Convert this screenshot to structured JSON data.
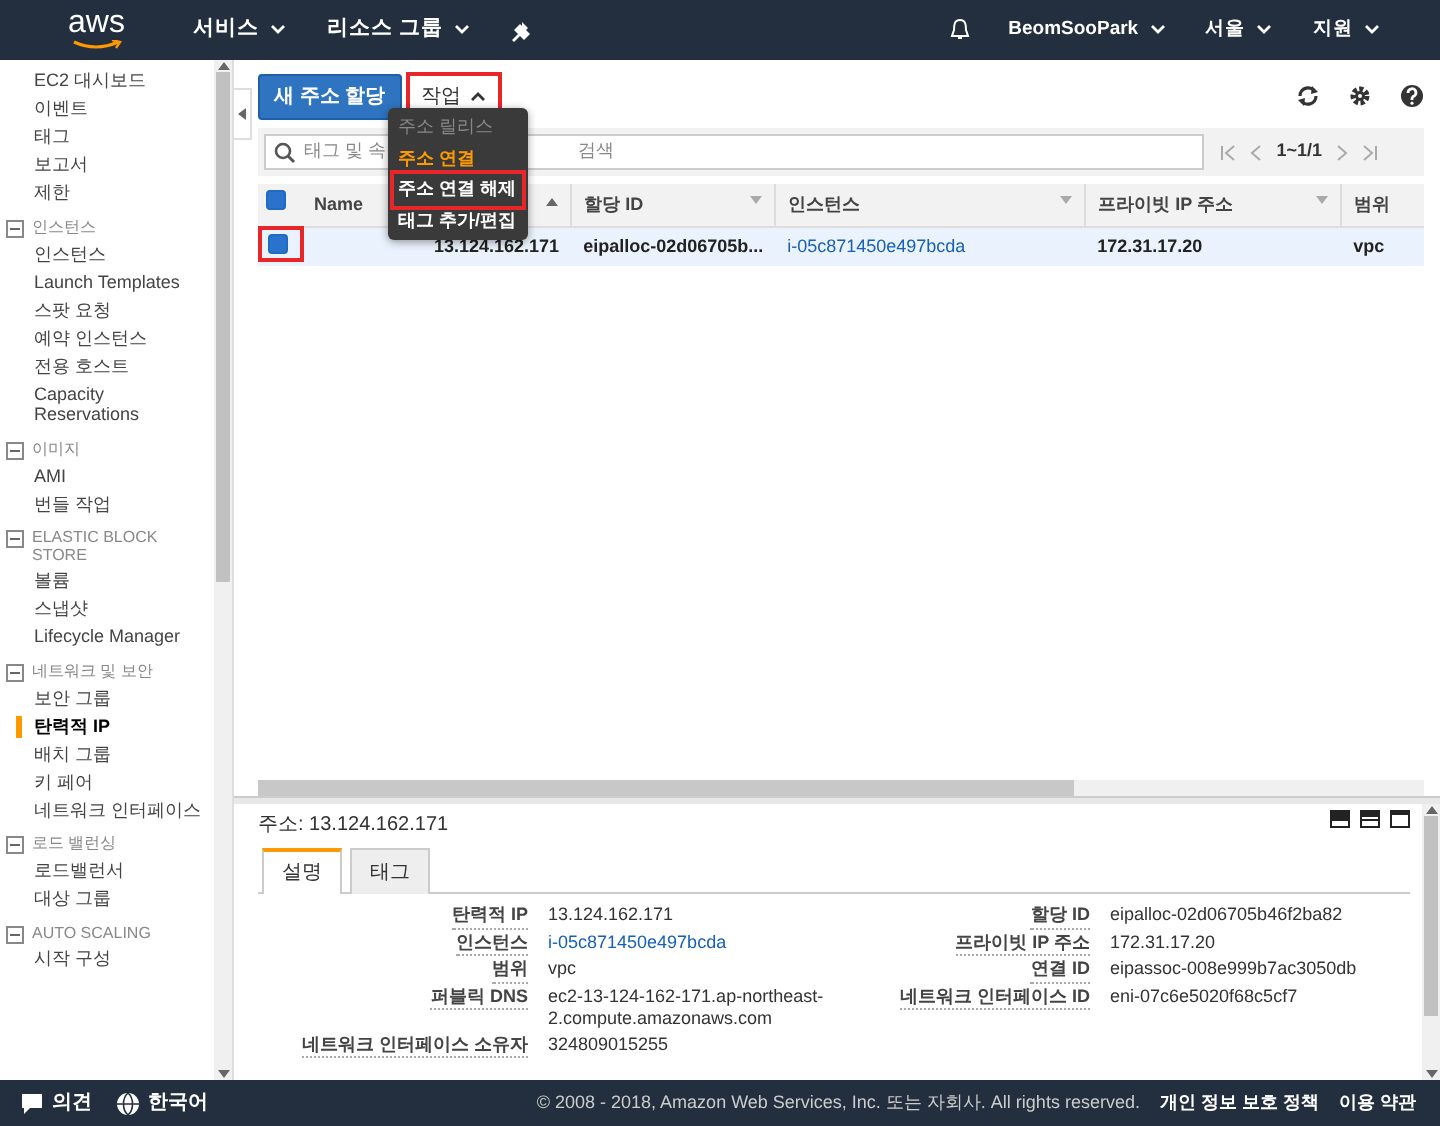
{
  "top_nav": {
    "logo": "aws",
    "menus": [
      {
        "label": "서비스"
      },
      {
        "label": "리소스 그룹"
      }
    ],
    "right_menus": [
      {
        "label": "BeomSooPark"
      },
      {
        "label": "서울"
      },
      {
        "label": "지원"
      }
    ]
  },
  "sidebar": {
    "items": [
      {
        "label": "EC2 대시보드",
        "selected": false
      },
      {
        "label": "이벤트",
        "selected": false
      },
      {
        "label": "태그",
        "selected": false
      },
      {
        "label": "보고서",
        "selected": false
      },
      {
        "label": "제한",
        "selected": false
      }
    ],
    "sections": [
      {
        "label": "인스턴스",
        "expanded": true,
        "items": [
          {
            "label": "인스턴스",
            "selected": false
          },
          {
            "label": "Launch Templates",
            "selected": false
          },
          {
            "label": "스팟 요청",
            "selected": false
          },
          {
            "label": "예약 인스턴스",
            "selected": false
          },
          {
            "label": "전용 호스트",
            "selected": false
          },
          {
            "label": "Capacity Reservations",
            "selected": false
          }
        ]
      },
      {
        "label": "이미지",
        "expanded": true,
        "items": [
          {
            "label": "AMI",
            "selected": false
          },
          {
            "label": "번들 작업",
            "selected": false
          }
        ]
      },
      {
        "label": "ELASTIC BLOCK STORE",
        "expanded": true,
        "items": [
          {
            "label": "볼륨",
            "selected": false
          },
          {
            "label": "스냅샷",
            "selected": false
          },
          {
            "label": "Lifecycle Manager",
            "selected": false
          }
        ]
      },
      {
        "label": "네트워크 및 보안",
        "expanded": true,
        "items": [
          {
            "label": "보안 그룹",
            "selected": false
          },
          {
            "label": "탄력적 IP",
            "selected": true
          },
          {
            "label": "배치 그룹",
            "selected": false
          },
          {
            "label": "키 페어",
            "selected": false
          },
          {
            "label": "네트워크 인터페이스",
            "selected": false
          }
        ]
      },
      {
        "label": "로드 밸런싱",
        "expanded": true,
        "items": [
          {
            "label": "로드밸런서",
            "selected": false
          },
          {
            "label": "대상 그룹",
            "selected": false
          }
        ]
      },
      {
        "label": "AUTO SCALING",
        "expanded": true,
        "items": [
          {
            "label": "시작 구성",
            "selected": false
          }
        ]
      }
    ]
  },
  "toolbar": {
    "primary_button": "새 주소 할당",
    "actions_button": {
      "label": "작업",
      "expanded": true,
      "annotated": true
    }
  },
  "actions_menu": [
    {
      "label": "주소 릴리스",
      "disabled": true,
      "hovered": false,
      "annotated": false
    },
    {
      "label": "주소 연결",
      "disabled": false,
      "hovered": true,
      "annotated": false
    },
    {
      "label": "주소 연결 해제",
      "disabled": false,
      "hovered": false,
      "annotated": true
    },
    {
      "label": "태그 추가/편집",
      "disabled": false,
      "hovered": false,
      "annotated": false
    }
  ],
  "search": {
    "placeholder_start": "태그 및 속",
    "placeholder_end": "검색"
  },
  "pagination": {
    "range": "1~1/1"
  },
  "table": {
    "select_all_checked": true,
    "columns": [
      {
        "label": "Name",
        "sorted": false,
        "menu_caret": false
      },
      {
        "sorted": true
      },
      {
        "label": "할당 ID",
        "sorted": false,
        "menu_caret": true
      },
      {
        "label": "인스턴스",
        "sorted": false,
        "menu_caret": true
      },
      {
        "label": "프라이빗 IP 주소",
        "sorted": false,
        "menu_caret": true
      },
      {
        "label": "범위",
        "sorted": false,
        "menu_caret": false
      }
    ],
    "rows": [
      {
        "selected": true,
        "annotated": true,
        "cells": [
          {
            "text": ""
          },
          {
            "text": "13.124.162.171",
            "kind": "text"
          },
          {
            "text": "eipalloc-02d06705b...",
            "kind": "text"
          },
          {
            "text": "i-05c871450e497bcda",
            "kind": "link"
          },
          {
            "text": "172.31.17.20",
            "kind": "text"
          },
          {
            "text": "vpc",
            "kind": "text"
          }
        ]
      }
    ]
  },
  "details": {
    "title": "주소: 13.124.162.171",
    "tabs": [
      {
        "label": "설명",
        "selected": true
      },
      {
        "label": "태그",
        "selected": false
      }
    ],
    "left_fields": [
      {
        "label": "탄력적 IP",
        "value": "13.124.162.171"
      },
      {
        "label": "인스턴스",
        "value": "i-05c871450e497bcda",
        "kind": "link"
      },
      {
        "label": "범위",
        "value": "vpc"
      },
      {
        "label": "퍼블릭 DNS",
        "value": "ec2-13-124-162-171.ap-northeast-2.compute.amazonaws.com"
      },
      {
        "label": "네트워크 인터페이스 소유자",
        "value": "324809015255"
      }
    ],
    "right_fields": [
      {
        "label": "할당 ID",
        "value": "eipalloc-02d06705b46f2ba82"
      },
      {
        "label": "프라이빗 IP 주소",
        "value": "172.31.17.20"
      },
      {
        "label": "연결 ID",
        "value": "eipassoc-008e999b7ac3050db"
      },
      {
        "label": "네트워크 인터페이스 ID",
        "value": "eni-07c6e5020f68c5cf7"
      }
    ]
  },
  "footer": {
    "feedback": "의견",
    "language": "한국어",
    "copyright": "© 2008 - 2018, Amazon Web Services, Inc. 또는 자회사. All rights reserved.",
    "links": [
      "개인 정보 보호 정책",
      "이용 약관"
    ]
  }
}
